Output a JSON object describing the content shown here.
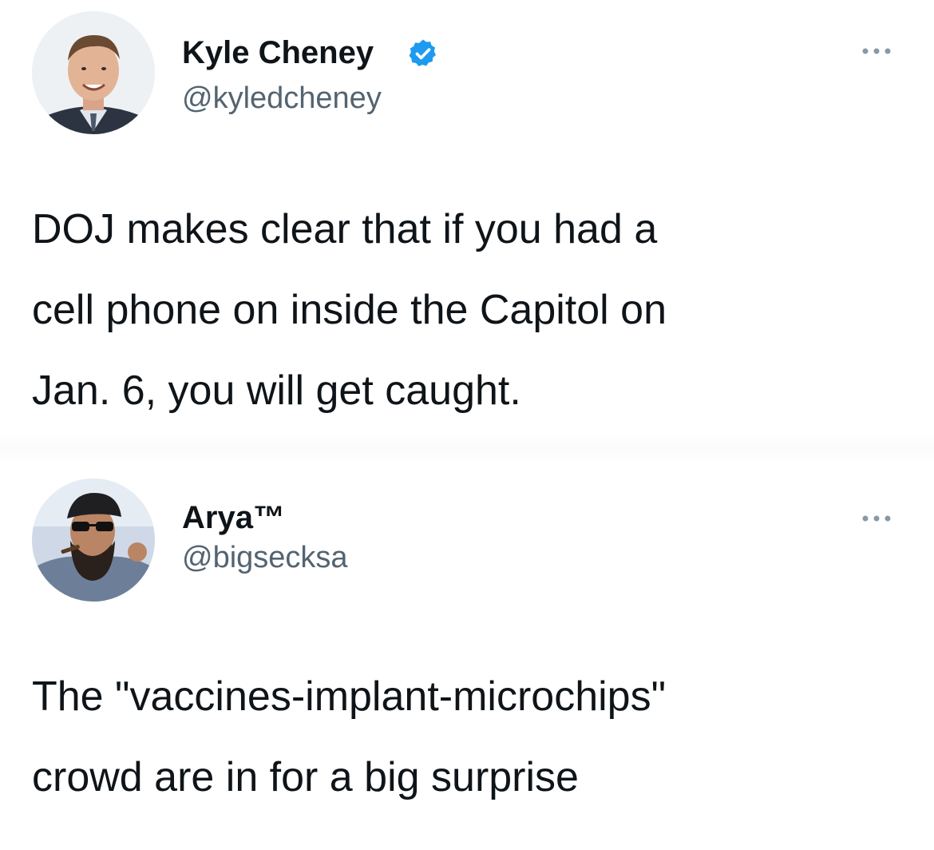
{
  "tweets": [
    {
      "author": {
        "display_name": "Kyle Cheney",
        "handle": "@kyledcheney",
        "verified": true
      },
      "text": "DOJ makes clear that if you had a\ncell phone on inside the Capitol on\nJan. 6, you will get caught.",
      "more_icon": "more-horizontal-icon"
    },
    {
      "author": {
        "display_name": "Arya™",
        "handle": "@bigsecksa",
        "verified": false
      },
      "text": "The \"vaccines-implant-microchips\"\ncrowd are in for a big surprise",
      "more_icon": "more-horizontal-icon"
    }
  ],
  "colors": {
    "text": "#0f1419",
    "secondary": "#536471",
    "verified": "#1d9bf0"
  }
}
